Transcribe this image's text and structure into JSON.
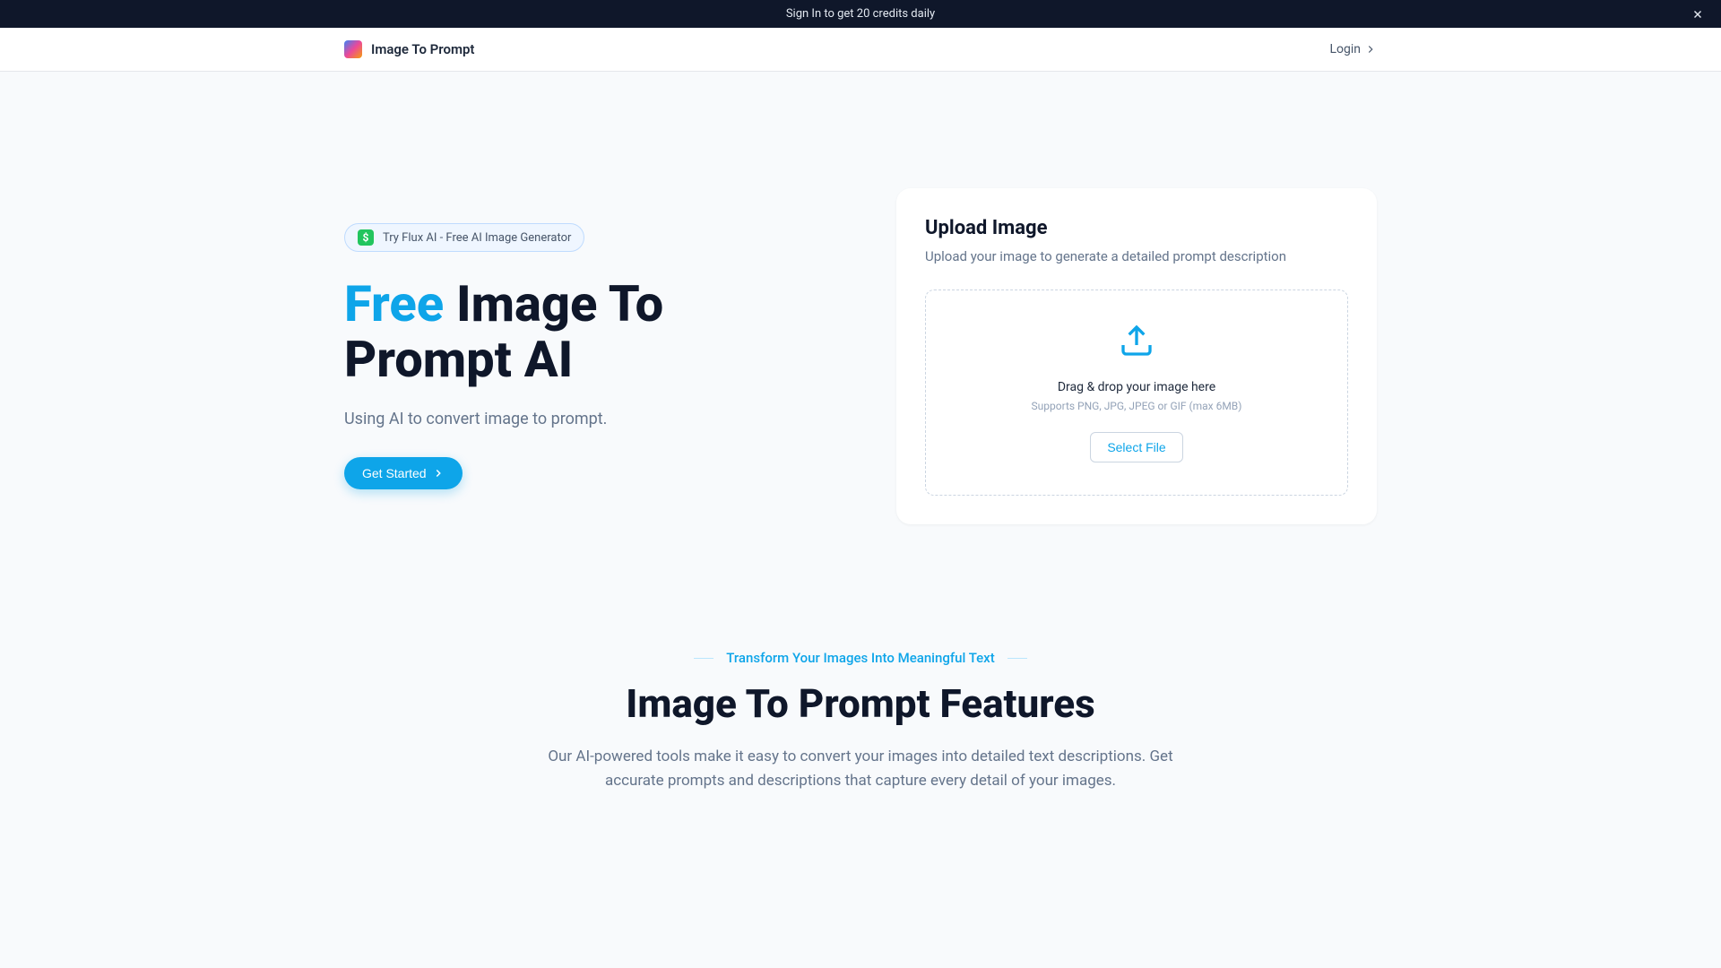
{
  "banner": {
    "text": "Sign In to get 20 credits daily"
  },
  "header": {
    "brand": "Image To Prompt",
    "login": "Login"
  },
  "hero": {
    "pill_label": "Try Flux AI - Free AI Image Generator",
    "title_accent": "Free",
    "title_rest": " Image To Prompt AI",
    "subtitle": "Using AI to convert image to prompt.",
    "cta": "Get Started"
  },
  "upload": {
    "title": "Upload Image",
    "subtitle": "Upload your image to generate a detailed prompt description",
    "drop_text": "Drag & drop your image here",
    "hint": "Supports PNG, JPG, JPEG or GIF (max 6MB)",
    "button": "Select File"
  },
  "features": {
    "eyebrow": "Transform Your Images Into Meaningful Text",
    "title": "Image To Prompt Features",
    "subtitle": "Our AI-powered tools make it easy to convert your images into detailed text descriptions. Get accurate prompts and descriptions that capture every detail of your images."
  },
  "colors": {
    "accent": "#0ea5e9",
    "dark": "#0f172a",
    "muted": "#64748b"
  }
}
